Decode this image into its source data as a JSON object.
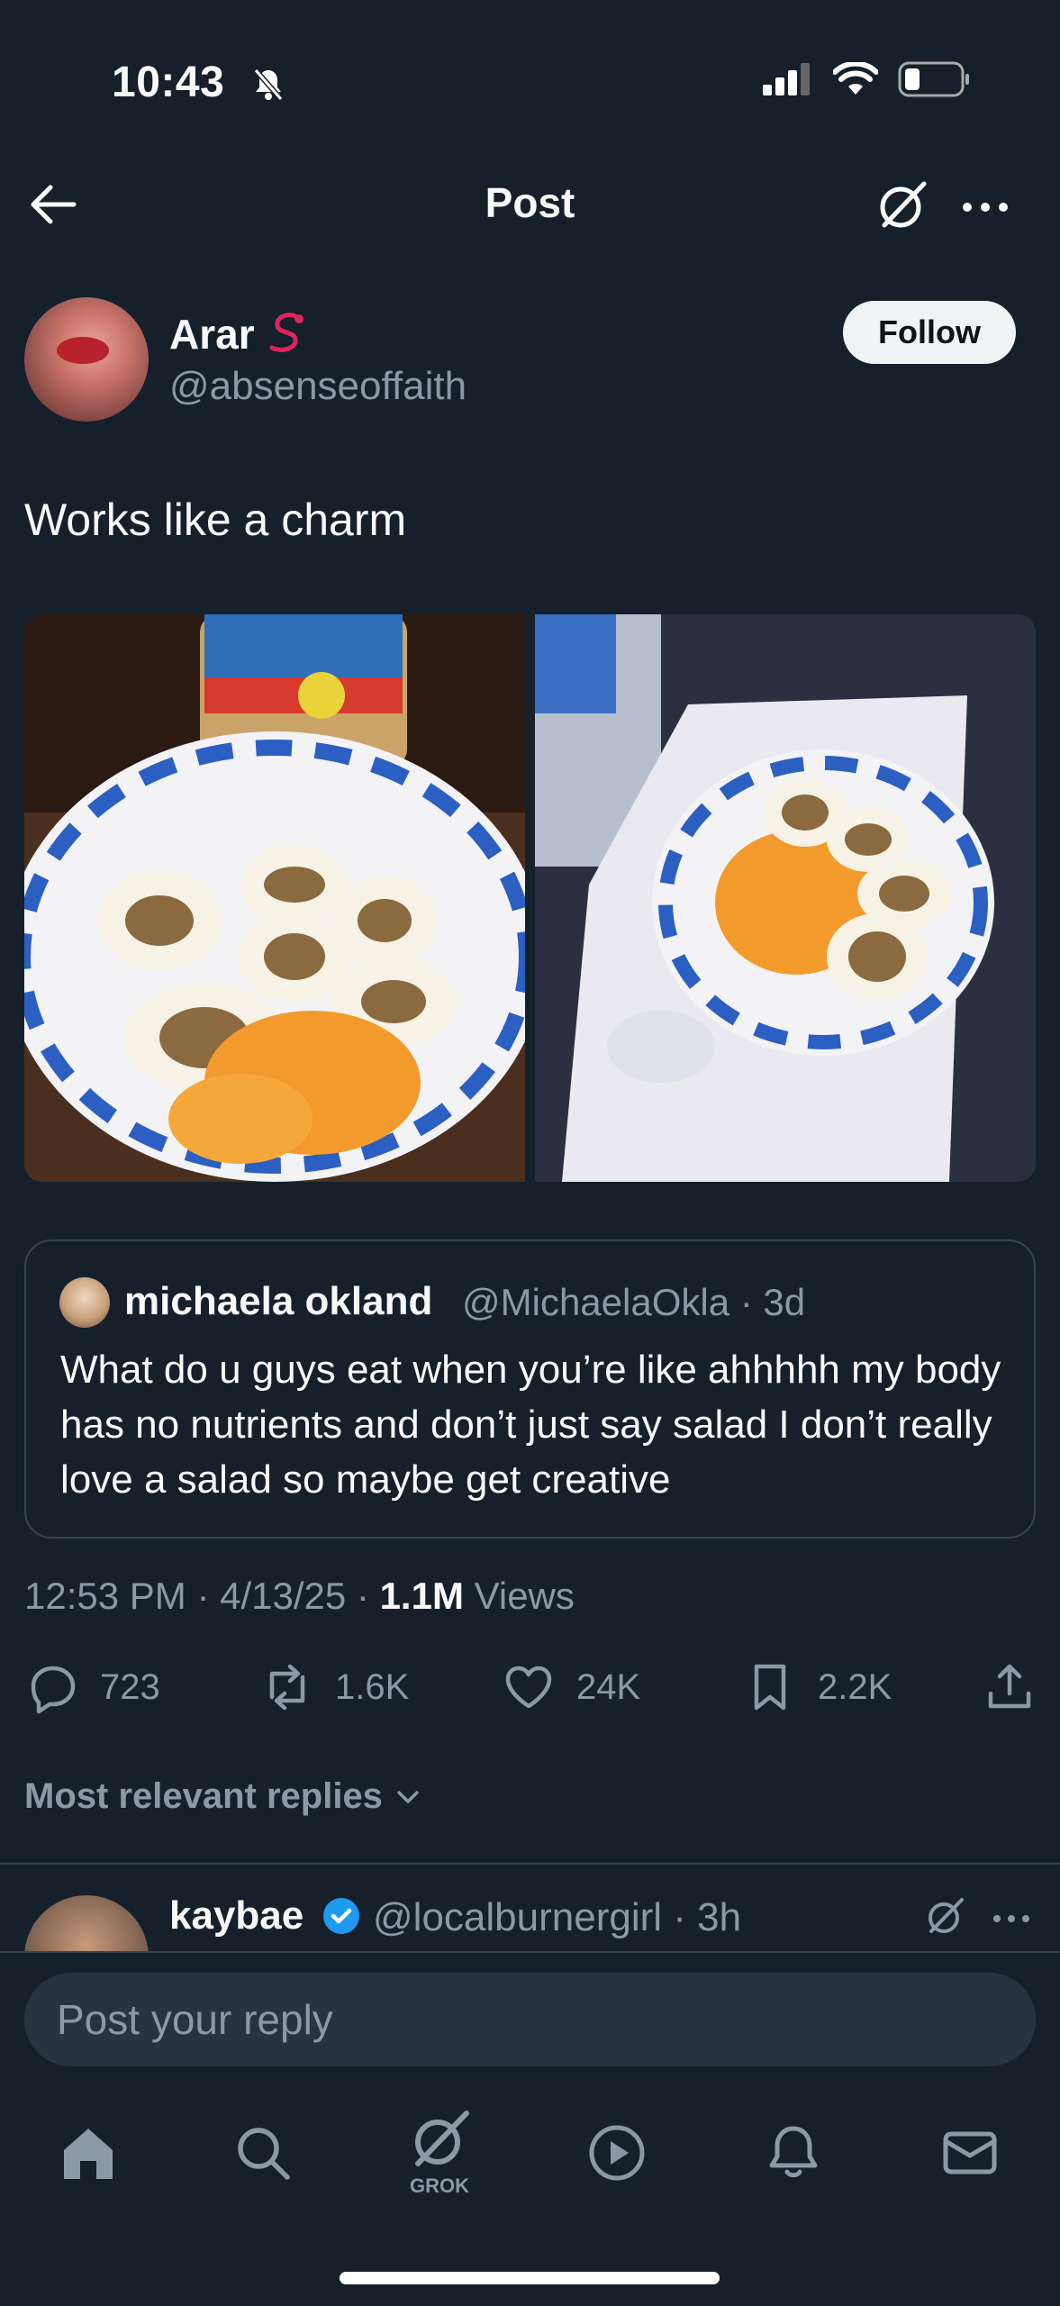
{
  "status_bar": {
    "time": "10:43"
  },
  "header": {
    "title": "Post"
  },
  "post": {
    "author_name": "Arar",
    "author_handle": "@absenseoffaith",
    "follow_label": "Follow",
    "text": "Works like a charm",
    "images": [
      "jif-peanut-butter-eggs-oranges-photo",
      "paper-bowl-eggs-oranges-photo"
    ],
    "quote": {
      "name": "michaela okland",
      "handle_time": "@MichaelaOkla · 3d",
      "text": "What do u guys eat when you’re like ahhhhh my body has no nutrients and don’t just say salad I don’t really love a salad so maybe get creative"
    },
    "timestamp": "12:53 PM · 4/13/25 · ",
    "views_count": "1.1M",
    "views_label": " Views",
    "actions": {
      "replies": "723",
      "reposts": "1.6K",
      "likes": "24K",
      "bookmarks": "2.2K"
    }
  },
  "replies_sort": "Most relevant replies",
  "reply_preview": {
    "name": "kaybae",
    "handle_time": "@localburnergirl · 3h"
  },
  "composer": {
    "placeholder": "Post your reply"
  },
  "bottom_nav": {
    "grok_label": "GROK"
  },
  "colors": {
    "background": "#15202b",
    "secondary_text": "#8b98a5",
    "verified": "#1d9bf0",
    "border": "#38444d"
  }
}
